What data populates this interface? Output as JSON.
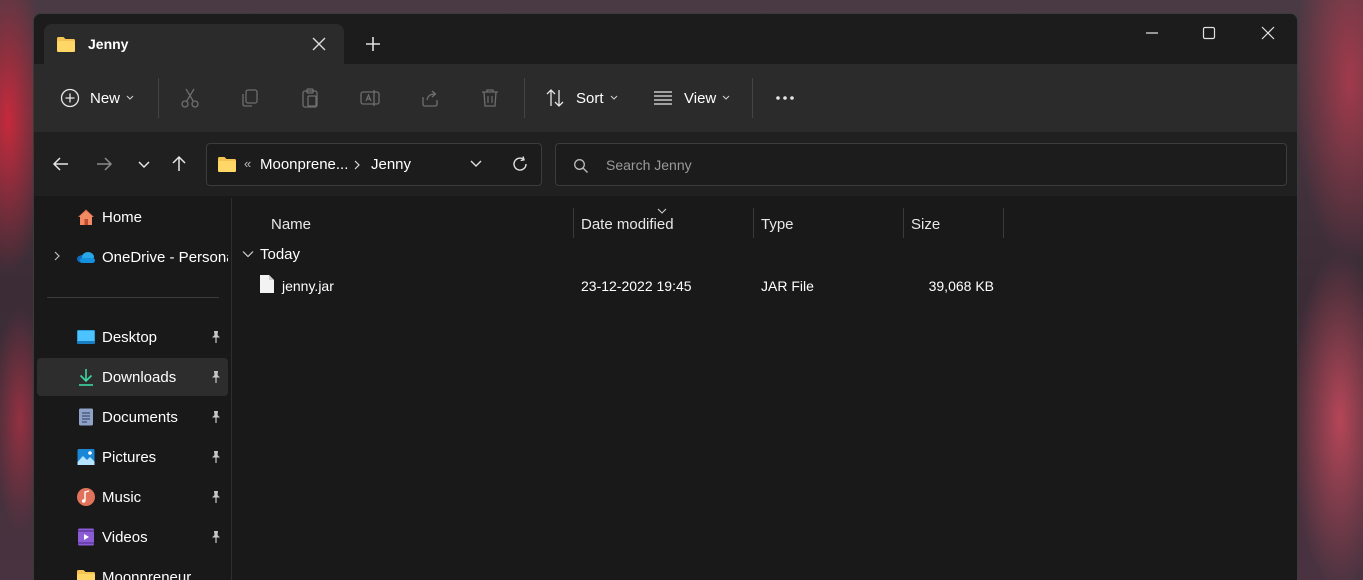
{
  "window": {
    "tab_title": "Jenny"
  },
  "toolbar": {
    "new_label": "New",
    "sort_label": "Sort",
    "view_label": "View"
  },
  "address": {
    "crumbs": [
      "Moonprene...",
      "Jenny"
    ],
    "overflow": "«"
  },
  "search": {
    "placeholder": "Search Jenny"
  },
  "sidebar": {
    "items": [
      {
        "label": "Home",
        "icon": "home-icon"
      },
      {
        "label": "OneDrive - Persona",
        "icon": "onedrive-icon"
      },
      {
        "label": "Desktop",
        "icon": "desktop-icon"
      },
      {
        "label": "Downloads",
        "icon": "downloads-icon"
      },
      {
        "label": "Documents",
        "icon": "documents-icon"
      },
      {
        "label": "Pictures",
        "icon": "pictures-icon"
      },
      {
        "label": "Music",
        "icon": "music-icon"
      },
      {
        "label": "Videos",
        "icon": "videos-icon"
      },
      {
        "label": "Moonpreneur",
        "icon": "folder-icon"
      }
    ]
  },
  "columns": {
    "name": "Name",
    "date": "Date modified",
    "type": "Type",
    "size": "Size"
  },
  "group": {
    "label": "Today"
  },
  "files": [
    {
      "name": "jenny.jar",
      "date": "23-12-2022 19:45",
      "type": "JAR File",
      "size": "39,068 KB"
    }
  ],
  "colors": {
    "folder": "#f5c451",
    "accent": "#4cc2ff",
    "window_bg": "#191919"
  }
}
